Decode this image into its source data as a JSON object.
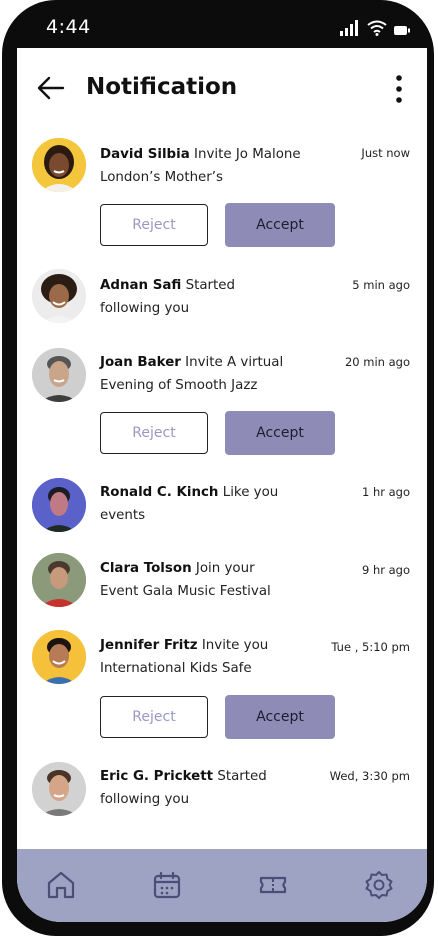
{
  "status_bar": {
    "time": "4:44"
  },
  "header": {
    "title": "Notification"
  },
  "notifications": [
    {
      "name": "David Silbia",
      "text_line1": "Invite Jo Malone",
      "text_line2": "London’s Mother’s",
      "time": "Just now",
      "has_actions": true,
      "avatar_bg": "#f3c63b"
    },
    {
      "name": "Adnan Safi",
      "text_line1": "Started",
      "text_line2": "following you",
      "time": "5 min ago",
      "has_actions": false,
      "avatar_bg": "#e9e9e9"
    },
    {
      "name": "Joan Baker",
      "text_line1": "Invite A virtual",
      "text_line2": "Evening of Smooth Jazz",
      "time": "20 min ago",
      "has_actions": true,
      "avatar_bg": "#d0d0d0"
    },
    {
      "name": "Ronald C. Kinch",
      "text_line1": "Like you",
      "text_line2": "events",
      "time": "1 hr ago",
      "has_actions": false,
      "avatar_bg": "#5560c8"
    },
    {
      "name": "Clara Tolson",
      "text_line1": "Join your",
      "text_line2": "Event Gala Music Festival",
      "time": "9 hr ago",
      "has_actions": false,
      "avatar_bg": "#8fa07c"
    },
    {
      "name": "Jennifer Fritz",
      "text_line1": "Invite you",
      "text_line2": "International Kids Safe",
      "time": "Tue , 5:10 pm",
      "has_actions": true,
      "avatar_bg": "#f3c63b"
    },
    {
      "name": "Eric G. Prickett",
      "text_line1": "Started",
      "text_line2": "following you",
      "time": "Wed, 3:30 pm",
      "has_actions": false,
      "avatar_bg": "#cfcfcf"
    }
  ],
  "actions": {
    "reject_label": "Reject",
    "accept_label": "Accept"
  },
  "colors": {
    "accent": "#8e8cb6",
    "nav_bg": "#9ea3c4",
    "reject_text": "#9a97c2"
  },
  "nav_icons": [
    "home-icon",
    "calendar-icon",
    "ticket-icon",
    "settings-icon"
  ]
}
